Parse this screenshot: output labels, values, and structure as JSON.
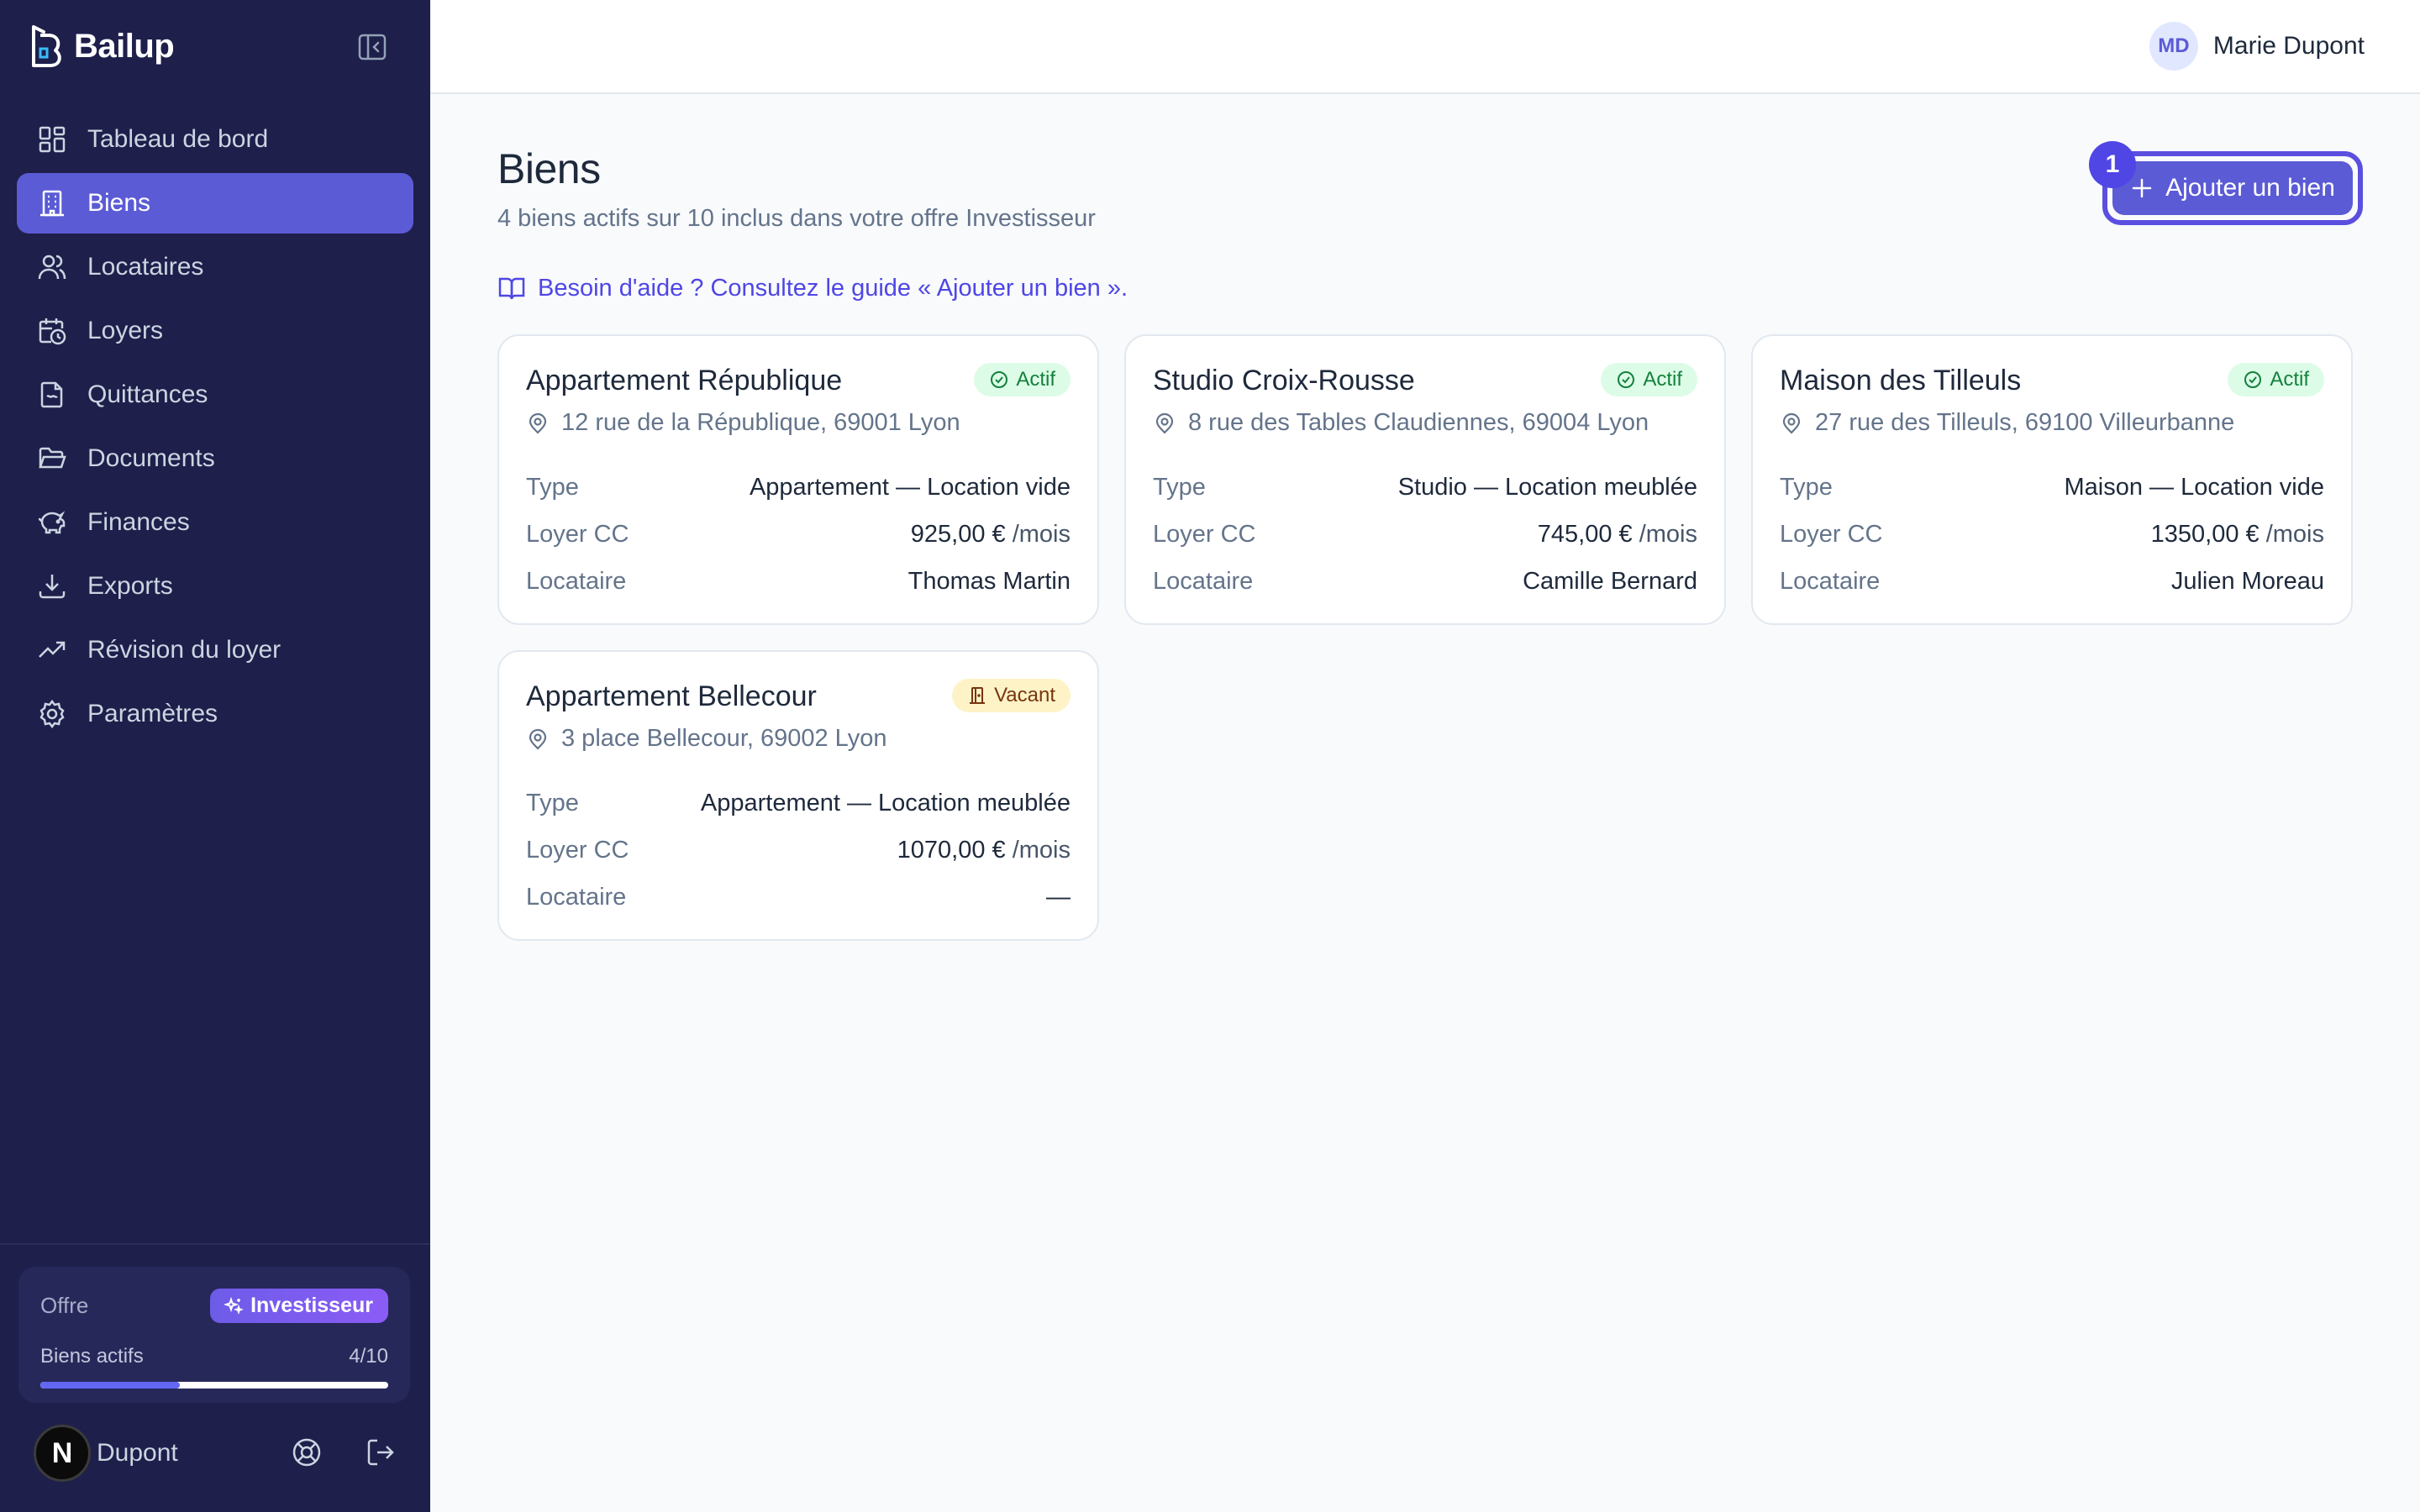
{
  "app": {
    "name": "Bailup"
  },
  "sidebar": {
    "items": [
      {
        "label": "Tableau de bord",
        "icon": "dashboard-icon"
      },
      {
        "label": "Biens",
        "icon": "building-icon",
        "active": true
      },
      {
        "label": "Locataires",
        "icon": "users-icon"
      },
      {
        "label": "Loyers",
        "icon": "calendar-clock-icon"
      },
      {
        "label": "Quittances",
        "icon": "receipt-icon"
      },
      {
        "label": "Documents",
        "icon": "folder-icon"
      },
      {
        "label": "Finances",
        "icon": "piggy-bank-icon"
      },
      {
        "label": "Exports",
        "icon": "download-icon"
      },
      {
        "label": "Révision du loyer",
        "icon": "trending-up-icon"
      },
      {
        "label": "Paramètres",
        "icon": "gear-icon"
      }
    ],
    "plan": {
      "label": "Offre",
      "badge": "Investisseur",
      "usage_label": "Biens actifs",
      "usage_text": "4/10",
      "usage_fraction": 0.4
    },
    "user": {
      "initial": "N",
      "name": "e Dupont"
    }
  },
  "header": {
    "avatar_initials": "MD",
    "user_name": "Marie Dupont"
  },
  "main": {
    "title": "Biens",
    "subtitle": "4 biens actifs sur 10 inclus dans votre offre Investisseur",
    "help_link": "Besoin d'aide ? Consultez le guide « Ajouter un bien ».",
    "add_button": "Ajouter un bien",
    "step_badge": "1",
    "labels": {
      "type": "Type",
      "rent": "Loyer CC",
      "tenant": "Locataire"
    },
    "properties": [
      {
        "title": "Appartement République",
        "status": "Actif",
        "address": "12 rue de la République, 69001 Lyon",
        "type": "Appartement — Location vide",
        "rent": "925,00 €",
        "per": "/mois",
        "tenant": "Thomas Martin"
      },
      {
        "title": "Studio Croix-Rousse",
        "status": "Actif",
        "address": "8 rue des Tables Claudiennes, 69004 Lyon",
        "type": "Studio — Location meublée",
        "rent": "745,00 €",
        "per": "/mois",
        "tenant": "Camille Bernard"
      },
      {
        "title": "Maison des Tilleuls",
        "status": "Actif",
        "address": "27 rue des Tilleuls, 69100 Villeurbanne",
        "type": "Maison — Location vide",
        "rent": "1350,00 €",
        "per": "/mois",
        "tenant": "Julien Moreau"
      },
      {
        "title": "Appartement Bellecour",
        "status": "Vacant",
        "address": "3 place Bellecour, 69002 Lyon",
        "type": "Appartement — Location meublée",
        "rent": "1070,00 €",
        "per": "/mois",
        "tenant": "—"
      }
    ]
  },
  "colors": {
    "sidebar_bg": "#1e1f4b",
    "accent": "#5b5bd6",
    "active_status": "#15803d",
    "vacant_status": "#78350f"
  }
}
